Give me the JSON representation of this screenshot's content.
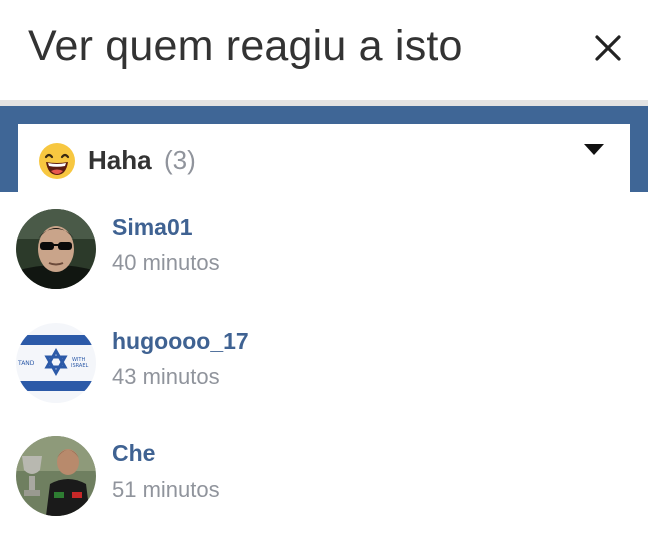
{
  "header": {
    "title": "Ver quem reagiu a isto",
    "close_icon": "close-icon"
  },
  "filter": {
    "emoji_icon": "laughing-emoji-icon",
    "label": "Haha",
    "count": "(3)",
    "dropdown_icon": "caret-down-icon"
  },
  "colors": {
    "band": "#3f6696",
    "name": "#3f6292",
    "meta": "#90949c"
  },
  "reactors": [
    {
      "name": "Sima01",
      "time": "40 minutos",
      "avatar_icon": "user-avatar-sunglasses"
    },
    {
      "name": "hugoooo_17",
      "time": "43 minutos",
      "avatar_icon": "user-avatar-israel-flag"
    },
    {
      "name": "Che",
      "time": "51 minutos",
      "avatar_icon": "user-avatar-trophy"
    }
  ]
}
